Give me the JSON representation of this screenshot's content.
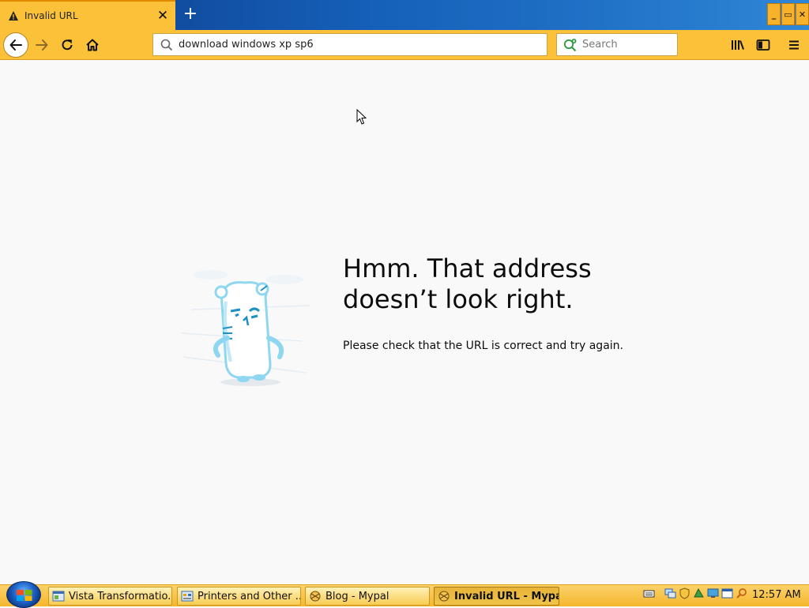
{
  "browser": {
    "tab": {
      "title": "Invalid URL",
      "close_glyph": "✕"
    },
    "new_tab_glyph": "+",
    "window_buttons": {
      "minimize": "_",
      "restore": "▭",
      "close": "✕"
    },
    "address_bar": {
      "value": "download windows xp sp6"
    },
    "search_bar": {
      "placeholder": "Search"
    }
  },
  "page": {
    "heading": "Hmm. That address doesn’t look right.",
    "description": "Please check that the URL is correct and try again."
  },
  "taskbar": {
    "items": [
      {
        "label": "Vista Transformatio...",
        "active": false
      },
      {
        "label": "Printers and Other ...",
        "active": false
      },
      {
        "label": "Blog - Mypal",
        "active": false
      },
      {
        "label": "Invalid URL - Mypal",
        "active": true
      }
    ],
    "clock": "12:57 AM"
  },
  "colors": {
    "accent": "#fbc239",
    "titlebar_blue": "#155fb8",
    "content_bg": "#f9f9fa",
    "illustration": "#7dd3f3"
  }
}
